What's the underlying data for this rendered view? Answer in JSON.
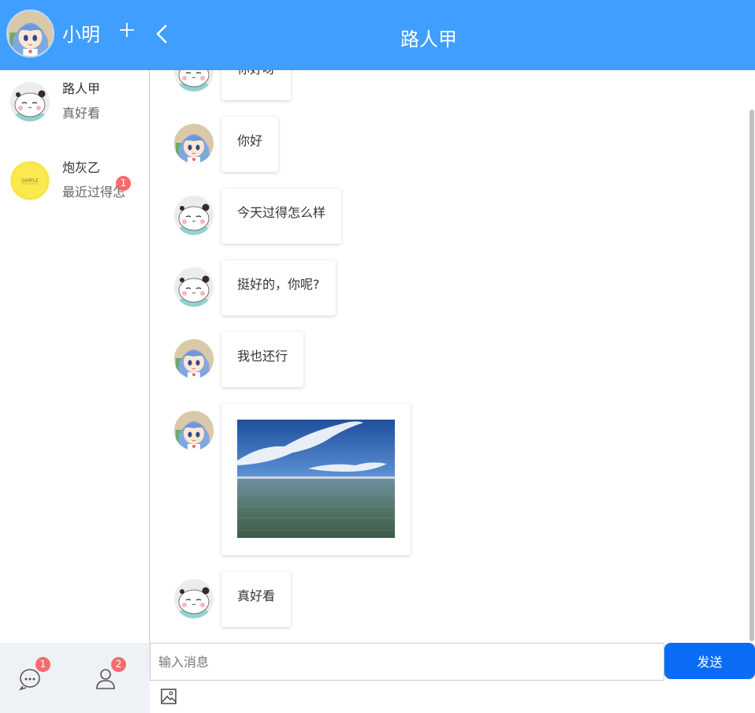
{
  "header": {
    "user_name": "小明",
    "chat_title": "路人甲"
  },
  "contacts": [
    {
      "name": "路人甲",
      "last_message": "真好看",
      "avatar": "panda-avatar"
    },
    {
      "name": "炮灰乙",
      "last_message": "最近过得怎",
      "avatar": "simple-avatar",
      "unread": "1",
      "avatar_text": "SIMPLE"
    }
  ],
  "messages": [
    {
      "sender": "路人甲",
      "avatar": "panda-avatar",
      "text": "你好呀"
    },
    {
      "sender": "小明",
      "avatar": "anime-girl-avatar",
      "text": "你好"
    },
    {
      "sender": "路人甲",
      "avatar": "panda-avatar",
      "text": "今天过得怎么样"
    },
    {
      "sender": "路人甲",
      "avatar": "panda-avatar",
      "text": "挺好的，你呢?"
    },
    {
      "sender": "小明",
      "avatar": "anime-girl-avatar",
      "text": "我也还行"
    },
    {
      "sender": "小明",
      "avatar": "anime-girl-avatar",
      "image": "sea-and-sky-photo"
    },
    {
      "sender": "路人甲",
      "avatar": "panda-avatar",
      "text": "真好看"
    }
  ],
  "footer_nav": {
    "chat_badge": "1",
    "contacts_badge": "2"
  },
  "composer": {
    "placeholder": "输入消息",
    "send_label": "发送"
  },
  "colors": {
    "header_blue": "#409EFF",
    "send_blue": "#0a6cf5",
    "badge_red": "#f56c6c"
  }
}
